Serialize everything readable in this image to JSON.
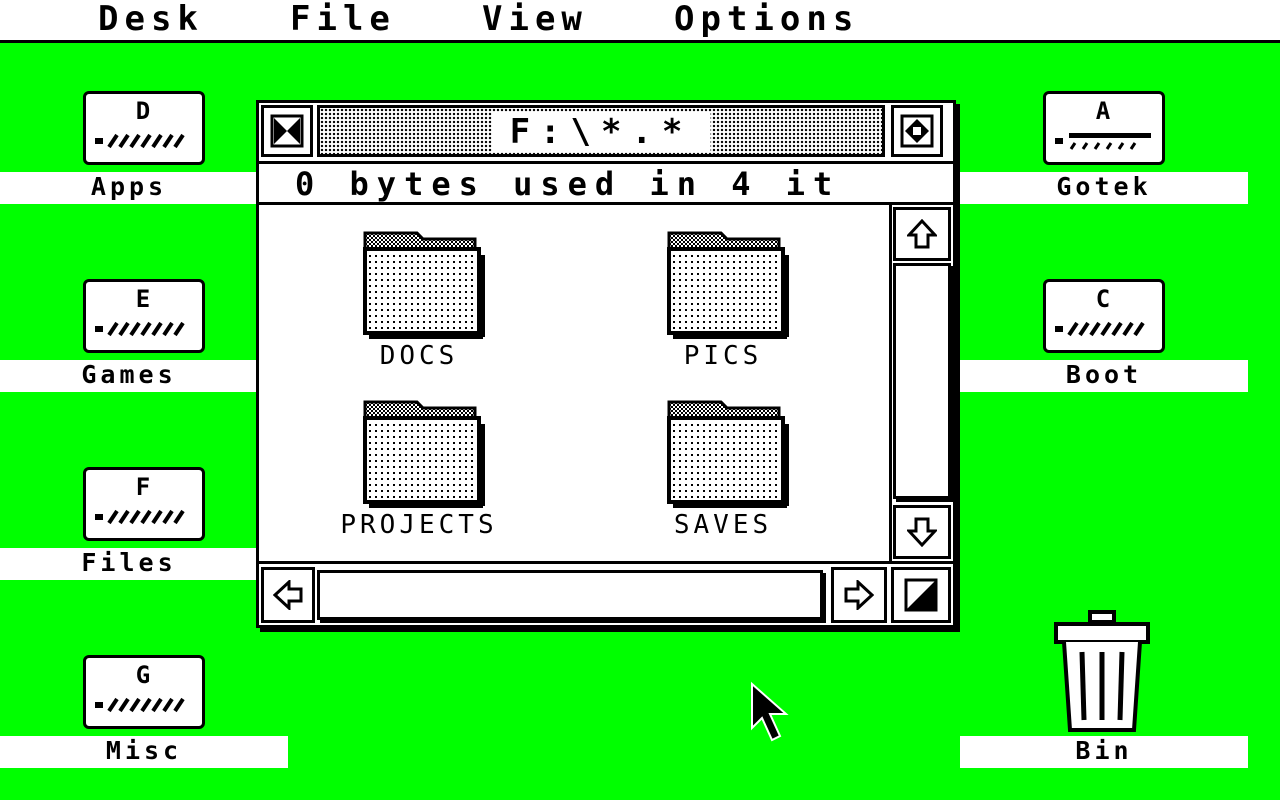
{
  "menubar": {
    "items": [
      {
        "label": "Desk"
      },
      {
        "label": "File"
      },
      {
        "label": "View"
      },
      {
        "label": "Options"
      }
    ]
  },
  "desktop": {
    "drives_left": [
      {
        "letter": "D",
        "label": "Apps"
      },
      {
        "letter": "E",
        "label": "Games"
      },
      {
        "letter": "F",
        "label": "Files"
      },
      {
        "letter": "G",
        "label": "Misc"
      }
    ],
    "drives_right": [
      {
        "letter": "A",
        "label": "Gotek"
      },
      {
        "letter": "C",
        "label": "Boot"
      }
    ],
    "trash": {
      "label": "Bin",
      "icon": "trash-can-icon"
    }
  },
  "window": {
    "title": "F:\\*.*",
    "info": "0 bytes used in 4 it",
    "folders": [
      {
        "label": "DOCS"
      },
      {
        "label": "PICS"
      },
      {
        "label": "PROJECTS"
      },
      {
        "label": "SAVES"
      }
    ]
  },
  "colors": {
    "desktop": "#00ff00",
    "foreground": "#000000",
    "window": "#ffffff"
  }
}
